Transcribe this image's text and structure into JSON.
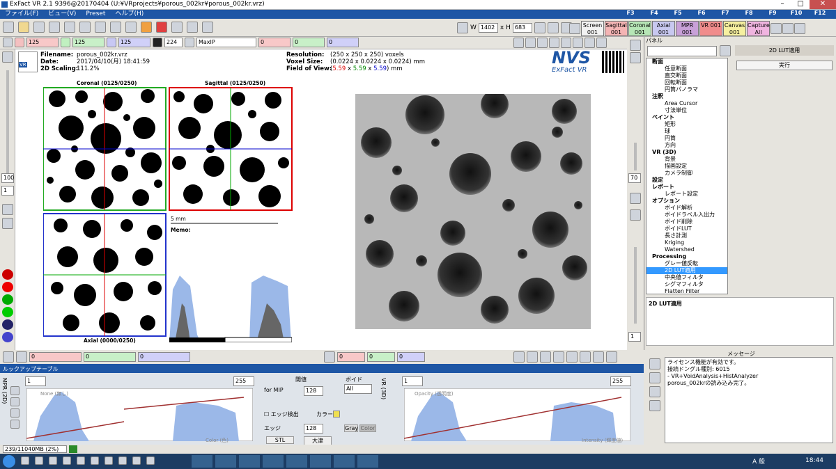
{
  "app": {
    "title": "ExFact VR 2.1 9396@20170404 (U:¥VRprojects¥porous_002kr¥porous_002kr.vrz)"
  },
  "menu": [
    "ファイル(F)",
    "ビュー(V)",
    "Preset",
    "ヘルプ(H)"
  ],
  "fkeys": [
    "F3",
    "F4",
    "F5",
    "F6",
    "F7",
    "F8",
    "F9",
    "F10",
    "F12"
  ],
  "views": [
    {
      "label": "Screen 001",
      "color": "#f2f2f2"
    },
    {
      "label": "Sagittal 001",
      "color": "#f4b4b4"
    },
    {
      "label": "Coronal 001",
      "color": "#b6e6b6"
    },
    {
      "label": "Axial 001",
      "color": "#c8c8f0"
    },
    {
      "label": "MPR 001",
      "color": "#c8a0d8"
    },
    {
      "label": "VR 001",
      "color": "#f08c8c"
    },
    {
      "label": "Canvas 001",
      "color": "#f6f0a0"
    },
    {
      "label": "Capture All",
      "color": "#f0b4e0"
    }
  ],
  "toolbar": {
    "w_label": "W",
    "w_value": "1402",
    "h_label": "x H",
    "h_value": "683",
    "slice1": "125",
    "slice2": "125",
    "slice3": "125",
    "thickness": "224",
    "render_mode": "MaxIP",
    "val0a": "0",
    "val0b": "0",
    "val0c": "0"
  },
  "info": {
    "filename_label": "Filename:",
    "filename": "porous_002kr.vrz",
    "date_label": "Date:",
    "date": "2017/04/10(月) 18:41:59",
    "scaling_label": "2D Scaling:",
    "scaling": "111.2%",
    "res_label": "Resolution:",
    "resolution": "(250 x 250 x 250) voxels",
    "voxel_label": "Voxel Size:",
    "voxel": "(0.0224 x 0.0224 x 0.0224) mm",
    "fov_label": "Field of View:",
    "fov_a": "5.59",
    "fov_b": "5.59",
    "fov_c": "5.59",
    "fov_unit": "mm",
    "logo": "NVS",
    "logo_sub": "ExFact VR"
  },
  "viewer": {
    "coronal": "Coronal (0125/0250)",
    "sagittal": "Sagittal (0125/0250)",
    "axial": "Axial (0000/0250)",
    "scale": "5 mm",
    "memo": "Memo:"
  },
  "leftbar": {
    "zoom": "100",
    "ratio": "1"
  },
  "rightbar": {
    "zoom": "70",
    "ratio": "1"
  },
  "panel": {
    "title": "パネル",
    "lut_button": "2D LUT適用",
    "exec": "実行",
    "section": "2D LUT適用"
  },
  "tree": [
    {
      "label": "断面",
      "level": 0,
      "bold": true
    },
    {
      "label": "任意断面",
      "level": 1
    },
    {
      "label": "直交断面",
      "level": 1
    },
    {
      "label": "回転断面",
      "level": 1
    },
    {
      "label": "円筒パノラマ",
      "level": 1
    },
    {
      "label": "注釈",
      "level": 0,
      "bold": true
    },
    {
      "label": "Area Cursor",
      "level": 1
    },
    {
      "label": "寸法単位",
      "level": 1
    },
    {
      "label": "ペイント",
      "level": 0,
      "bold": true
    },
    {
      "label": "矩形",
      "level": 1
    },
    {
      "label": "球",
      "level": 1
    },
    {
      "label": "円筒",
      "level": 1
    },
    {
      "label": "方向",
      "level": 1
    },
    {
      "label": "VR (3D)",
      "level": 0,
      "bold": true
    },
    {
      "label": "背景",
      "level": 1
    },
    {
      "label": "描画設定",
      "level": 1
    },
    {
      "label": "カメラ制御",
      "level": 1
    },
    {
      "label": "設定",
      "level": 0,
      "bold": true
    },
    {
      "label": "レポート",
      "level": 0,
      "bold": true
    },
    {
      "label": "レポート設定",
      "level": 1
    },
    {
      "label": "オプション",
      "level": 0,
      "bold": true
    },
    {
      "label": "ボイド解析",
      "level": 1
    },
    {
      "label": "ボイドラベル入出力",
      "level": 1
    },
    {
      "label": "ボイド削除",
      "level": 1
    },
    {
      "label": "ボイドLUT",
      "level": 1
    },
    {
      "label": "長さ計測",
      "level": 1
    },
    {
      "label": "Kriging",
      "level": 1
    },
    {
      "label": "Watershed",
      "level": 1
    },
    {
      "label": "Processing",
      "level": 0,
      "bold": true
    },
    {
      "label": "グレー値反転",
      "level": 1
    },
    {
      "label": "2D LUT適用",
      "level": 1,
      "selected": true
    },
    {
      "label": "中央値フィルタ",
      "level": 1
    },
    {
      "label": "シグマフィルタ",
      "level": 1
    },
    {
      "label": "Flatten Filter",
      "level": 1
    }
  ],
  "bottombar": {
    "v1": "0",
    "v2": "0",
    "v3": "0",
    "v4": "0",
    "v5": "0",
    "v6": "0"
  },
  "lut": {
    "title": "ルックアップテーブル",
    "mpr_tab": "MPR (2D)",
    "vr_tab": "VR (3D)",
    "min": "1",
    "max": "255",
    "none_label": "None (無し)",
    "color_label": "Color (色)",
    "threshold": "閾値",
    "void": "ボイド",
    "for_mip": "for MIP",
    "mip_val": "128",
    "edge_detect": "エッジ検出",
    "color": "カラー",
    "edge": "エッジ",
    "edge_val": "128",
    "all": "All",
    "gray": "Gray",
    "colorbtn": "Color",
    "stl": "STL",
    "otsu": "大津",
    "vr_min": "1",
    "vr_max": "255",
    "opacity": "Opacity (透明度)",
    "intensity": "Intensity (輝度値)"
  },
  "messages": {
    "title": "メッセージ",
    "lines": [
      "ライセンス機能が有効です。",
      "接続ドングル種別: 6015",
      "- VR+VoidAnalysis+HistAnalyzer",
      "porous_002krの読み込み完了。"
    ]
  },
  "status": {
    "memory": "239/11040MB (2%)"
  },
  "taskbar": {
    "time": "18:44",
    "lang": "A 般"
  }
}
